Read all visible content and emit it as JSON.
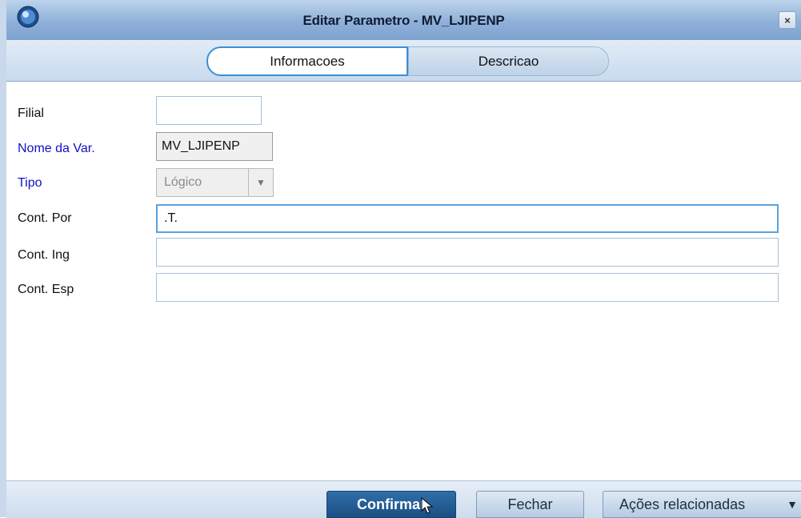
{
  "window": {
    "title": "Editar Parametro - MV_LJIPENP",
    "close_glyph": "×"
  },
  "tabs": [
    {
      "label": "Informacoes",
      "active": true
    },
    {
      "label": "Descricao",
      "active": false
    }
  ],
  "form": {
    "filial": {
      "label": "Filial",
      "value": ""
    },
    "nome_var": {
      "label": "Nome da Var.",
      "value": "MV_LJIPENP"
    },
    "tipo": {
      "label": "Tipo",
      "value": "Lógico"
    },
    "cont_por": {
      "label": "Cont. Por",
      "value": ".T."
    },
    "cont_ing": {
      "label": "Cont. Ing",
      "value": ""
    },
    "cont_esp": {
      "label": "Cont. Esp",
      "value": ""
    }
  },
  "footer": {
    "confirm_label": "Confirmar",
    "close_label": "Fechar",
    "actions_label": "Ações relacionadas"
  },
  "colors": {
    "accent_blue_label": "#1010c8",
    "confirm_button": "#1b4e83",
    "titlebar": "#8fb0d8"
  }
}
